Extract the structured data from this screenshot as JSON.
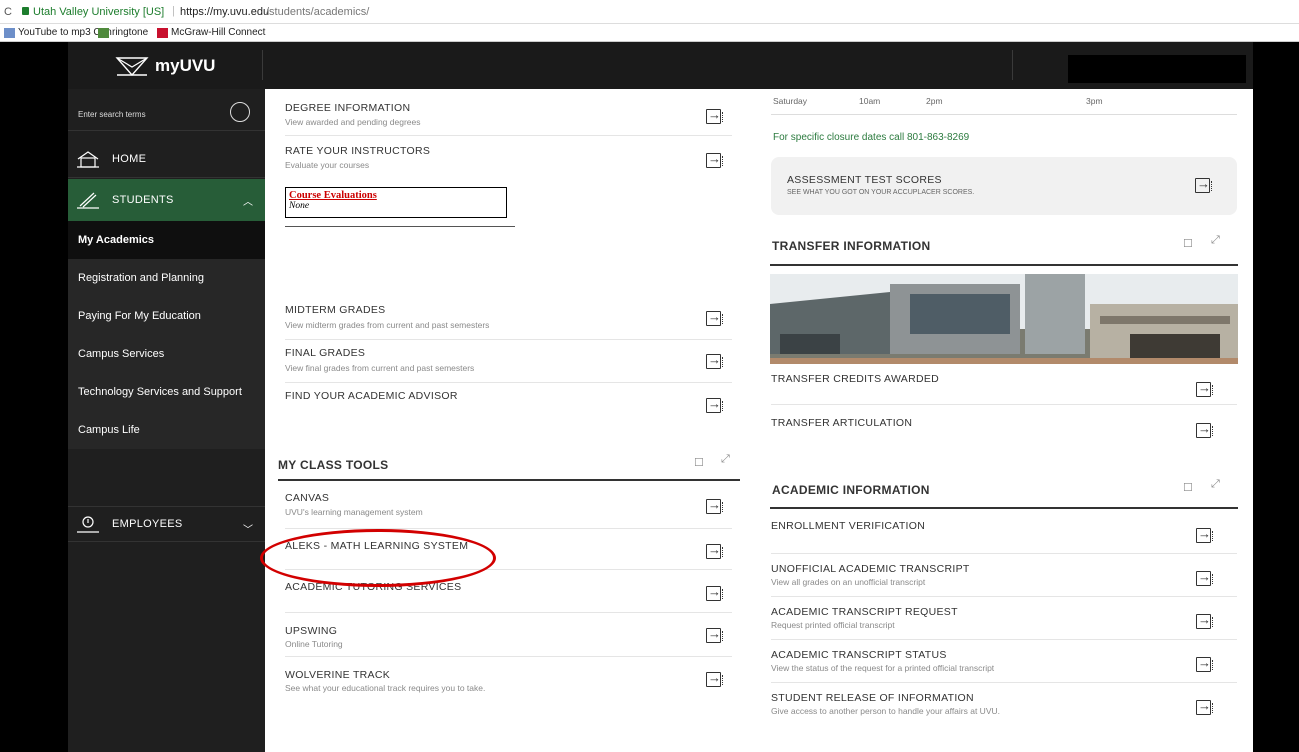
{
  "browser": {
    "reload_glyph": "C",
    "site_name": "Utah Valley University [US]",
    "separator": "|",
    "url_host": "https://my.uvu.edu",
    "url_path": "/students/academics/",
    "bookmarks": [
      {
        "label": "YouTube to mp3 Con",
        "icon": "youtube-mp3-icon"
      },
      {
        "label": "ringtone",
        "icon": "ringtone-icon"
      },
      {
        "label": "McGraw-Hill Connect",
        "icon": "mcgraw-hill-icon"
      }
    ]
  },
  "header": {
    "logo_text": "myUVU"
  },
  "sidebar": {
    "search_placeholder": "Enter search terms",
    "home": "HOME",
    "students": "STUDENTS",
    "employees": "EMPLOYEES",
    "sub_items": [
      "My Academics",
      "Registration and Planning",
      "Paying For My Education",
      "Campus Services",
      "Technology Services and Support",
      "Campus Life"
    ]
  },
  "academics": {
    "degree": {
      "title": "DEGREE INFORMATION",
      "sub": "View awarded and pending degrees"
    },
    "rate": {
      "title": "RATE YOUR INSTRUCTORS",
      "sub": "Evaluate your courses"
    },
    "course_eval": {
      "heading": "Course Evaluations",
      "value": "None"
    },
    "midterm": {
      "title": "MIDTERM GRADES",
      "sub": "View midterm grades from current and past semesters"
    },
    "final": {
      "title": "FINAL GRADES",
      "sub": "View final grades from current and past semesters"
    },
    "advisor": {
      "title": "FIND YOUR ACADEMIC ADVISOR"
    }
  },
  "class_tools": {
    "title": "MY CLASS TOOLS",
    "items": [
      {
        "title": "CANVAS",
        "sub": "UVU's learning management system"
      },
      {
        "title": "ALEKS - MATH LEARNING SYSTEM",
        "sub": ""
      },
      {
        "title": "ACADEMIC TUTORING SERVICES",
        "sub": ""
      },
      {
        "title": "UPSWING",
        "sub": "Online Tutoring"
      },
      {
        "title": "WOLVERINE TRACK",
        "sub": "See what your educational track requires you to take."
      }
    ]
  },
  "right": {
    "hours": {
      "day": "Saturday",
      "open": "10am",
      "close": "2pm",
      "extra": "3pm"
    },
    "closure": "For specific closure dates call 801-863-8269",
    "assessment": {
      "title": "ASSESSMENT TEST SCORES",
      "sub": "SEE WHAT YOU GOT ON YOUR ACCUPLACER SCORES."
    },
    "transfer": {
      "title": "TRANSFER INFORMATION",
      "items": [
        "TRANSFER CREDITS AWARDED",
        "TRANSFER ARTICULATION"
      ]
    },
    "academic_info": {
      "title": "ACADEMIC INFORMATION",
      "items": [
        {
          "title": "ENROLLMENT VERIFICATION",
          "sub": ""
        },
        {
          "title": "UNOFFICIAL ACADEMIC TRANSCRIPT",
          "sub": "View all grades on an unofficial transcript"
        },
        {
          "title": "ACADEMIC TRANSCRIPT REQUEST",
          "sub": "Request printed official transcript"
        },
        {
          "title": "ACADEMIC TRANSCRIPT STATUS",
          "sub": "View the status of the request for a printed official transcript"
        },
        {
          "title": "STUDENT RELEASE OF INFORMATION",
          "sub": "Give access to another person to handle your affairs at UVU."
        }
      ]
    }
  },
  "colors": {
    "uvu_green": "#275d38",
    "highlight_circle": "#d20000",
    "closure_text": "#2c7b3f"
  }
}
